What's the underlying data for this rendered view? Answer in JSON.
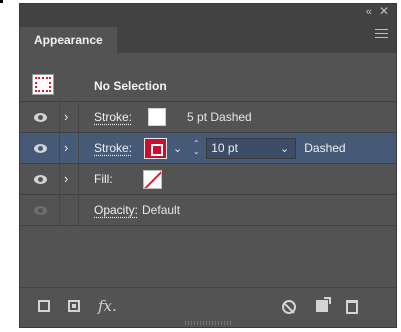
{
  "panel": {
    "tab_label": "Appearance",
    "collapse_glyph": "«",
    "close_glyph": "✕"
  },
  "header_row": {
    "title": "No Selection"
  },
  "rows": [
    {
      "label": "Stroke:",
      "swatch_color": "#ffffff",
      "detail": "5 pt Dashed",
      "visible": true,
      "expandable": true
    },
    {
      "label": "Stroke:",
      "swatch_color": "#c8102e",
      "weight": "10 pt",
      "style": "Dashed",
      "visible": true,
      "expandable": true,
      "selected": true
    },
    {
      "label": "Fill:",
      "swatch": "none",
      "visible": true,
      "expandable": true
    },
    {
      "label": "Opacity:",
      "value": "Default",
      "visible": false,
      "expandable": false
    }
  ],
  "bottom_bar": {
    "fx_label": "fx.",
    "icons": [
      "add-new-stroke-icon",
      "add-new-fill-icon",
      "add-effect-icon",
      "clear-appearance-icon",
      "duplicate-item-icon",
      "delete-item-icon"
    ]
  },
  "colors": {
    "panel_bg": "#535353",
    "tab_strip": "#424242",
    "selected_row": "#465a78",
    "stroke_red": "#c8102e"
  }
}
